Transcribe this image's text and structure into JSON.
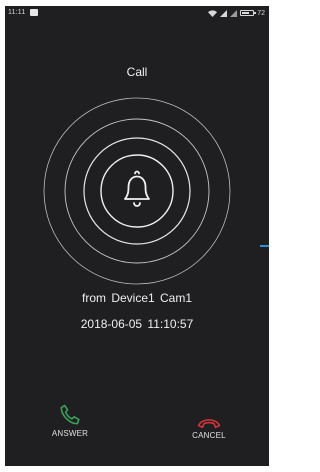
{
  "status_bar": {
    "time": "11:11",
    "battery": "72",
    "battery_level": 0.72,
    "icons": [
      "notification-icon",
      "wifi-icon",
      "signal-icon",
      "signal-icon",
      "battery-icon"
    ]
  },
  "call": {
    "title": "Call",
    "from": "from  Device1  Cam1",
    "timestamp": "2018-06-05  11:10:57",
    "icon": "bell-icon"
  },
  "actions": {
    "answer_label": "ANSWER",
    "cancel_label": "CANCEL",
    "answer_icon": "phone-answer-icon",
    "cancel_icon": "phone-hangup-icon"
  },
  "colors": {
    "background": "#1f1f21",
    "answer": "#3aa15a",
    "cancel": "#d3343a",
    "indicator": "#2f8fd8",
    "rings": "#d9d9d9"
  }
}
